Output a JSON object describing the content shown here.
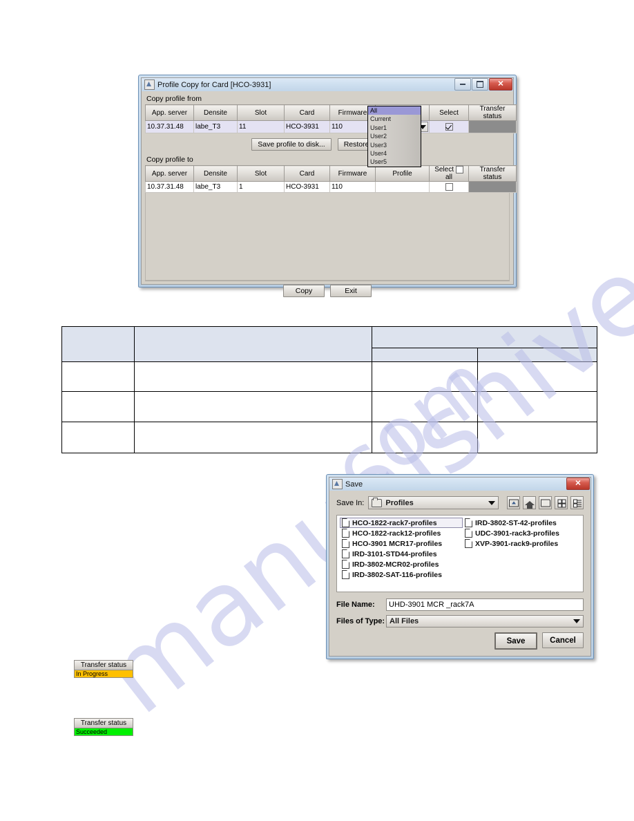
{
  "watermark": {
    "line1": "manualshive.",
    "line2": "com"
  },
  "profile_dialog": {
    "title": "Profile Copy for Card [HCO-3931]",
    "icon": "app-icon",
    "window_buttons": {
      "minimize": "minimize-button",
      "maximize": "maximize-button",
      "close": "close-button",
      "close_glyph": "✕"
    },
    "copy_from": {
      "label": "Copy profile from",
      "columns": [
        "App. server",
        "Densite",
        "Slot",
        "Card",
        "Firmware",
        "Profile",
        "Select",
        "Transfer status"
      ],
      "rows": [
        {
          "app_server": "10.37.31.48",
          "densite": "labe_T3",
          "slot": "11",
          "card": "HCO-3931",
          "firmware": "110",
          "profile": "All",
          "select_checked": true,
          "transfer_status": ""
        }
      ]
    },
    "mid_buttons": {
      "save": "Save profile to disk...",
      "restore": "Restore profile..."
    },
    "copy_to": {
      "label": "Copy profile to",
      "columns": [
        "App. server",
        "Densite",
        "Slot",
        "Card",
        "Firmware",
        "Profile",
        "Select",
        "Transfer status"
      ],
      "select_all_label": "all",
      "select_label": "Select",
      "select_all_checked": false,
      "rows": [
        {
          "app_server": "10.37.31.48",
          "densite": "labe_T3",
          "slot": "1",
          "card": "HCO-3931",
          "firmware": "110",
          "profile": "",
          "select_checked": false,
          "transfer_status": ""
        }
      ]
    },
    "profile_dropdown": {
      "selected": "All",
      "options": [
        "All",
        "Current",
        "User1",
        "User2",
        "User3",
        "User4",
        "User5"
      ]
    },
    "footer_buttons": {
      "copy": "Copy",
      "exit": "Exit"
    }
  },
  "doc_table": {
    "columns": 4,
    "header_rows": 2,
    "body_rows": 3,
    "cells": [
      [
        "",
        "",
        "",
        ""
      ],
      [
        "",
        "",
        "",
        ""
      ],
      [
        "",
        "",
        "",
        ""
      ]
    ]
  },
  "save_dialog": {
    "title": "Save",
    "icon": "app-icon",
    "close_glyph": "✕",
    "save_in_label": "Save In:",
    "save_in_value": "Profiles",
    "toolbar": [
      "up-one-level-icon",
      "home-icon",
      "new-folder-icon",
      "list-view-icon",
      "details-view-icon"
    ],
    "files": [
      {
        "name": "HCO-1822-rack7-profiles",
        "selected": true
      },
      {
        "name": "HCO-1822-rack12-profiles",
        "selected": false
      },
      {
        "name": "HCO-3901 MCR17-profiles",
        "selected": false
      },
      {
        "name": "IRD-3101-STD44-profiles",
        "selected": false
      },
      {
        "name": "IRD-3802-MCR02-profiles",
        "selected": false
      },
      {
        "name": "IRD-3802-SAT-116-profiles",
        "selected": false
      },
      {
        "name": "IRD-3802-ST-42-profiles",
        "selected": false
      },
      {
        "name": "UDC-3901-rack3-profiles",
        "selected": false
      },
      {
        "name": "XVP-3901-rack9-profiles",
        "selected": false
      }
    ],
    "file_name_label": "File Name:",
    "file_name_value": "UHD-3901 MCR _rack7A",
    "files_of_type_label": "Files of Type:",
    "files_of_type_value": "All Files",
    "buttons": {
      "save": "Save",
      "cancel": "Cancel"
    }
  },
  "status_badges": [
    {
      "header": "Transfer status",
      "value": "In Progress",
      "color": "#ffc000"
    },
    {
      "header": "Transfer status",
      "value": "Succeeded",
      "color": "#00f000"
    }
  ]
}
